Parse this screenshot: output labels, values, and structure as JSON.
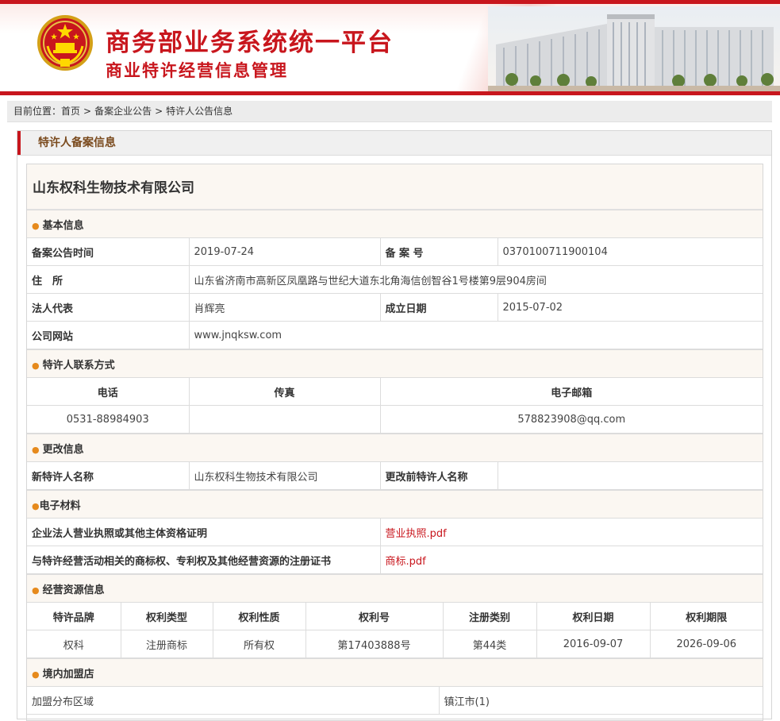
{
  "header": {
    "title_main": "商务部业务系统统一平台",
    "title_sub": "商业特许经营信息管理"
  },
  "breadcrumb": {
    "label": "目前位置：",
    "items": [
      "首页",
      "备案企业公告",
      "特许人公告信息"
    ],
    "separator": ">"
  },
  "panel": {
    "title": "特许人备案信息"
  },
  "company_name": "山东权科生物技术有限公司",
  "basic": {
    "section_title": "基本信息",
    "record_date_label": "备案公告时间",
    "record_date": "2019-07-24",
    "record_no_label": "备 案 号",
    "record_no": "0370100711900104",
    "address_label": "住　所",
    "address": "山东省济南市高新区凤凰路与世纪大道东北角海信创智谷1号楼第9层904房间",
    "legal_rep_label": "法人代表",
    "legal_rep": "肖辉亮",
    "founded_label": "成立日期",
    "founded": "2015-07-02",
    "website_label": "公司网站",
    "website": "www.jnqksw.com"
  },
  "contact": {
    "section_title": "特许人联系方式",
    "phone_label": "电话",
    "fax_label": "传真",
    "email_label": "电子邮箱",
    "phone": "0531-88984903",
    "fax": "",
    "email": "578823908@qq.com"
  },
  "change": {
    "section_title": "更改信息",
    "new_name_label": "新特许人名称",
    "new_name": "山东权科生物技术有限公司",
    "old_name_label": "更改前特许人名称",
    "old_name": ""
  },
  "materials": {
    "section_title": "电子材料",
    "license_label": "企业法人营业执照或其他主体资格证明",
    "license_file": "营业执照.pdf",
    "trademark_label": "与特许经营活动相关的商标权、专利权及其他经营资源的注册证书",
    "trademark_file": "商标.pdf"
  },
  "resources": {
    "section_title": "经营资源信息",
    "columns": [
      "特许品牌",
      "权利类型",
      "权利性质",
      "权利号",
      "注册类别",
      "权利日期",
      "权利期限"
    ],
    "rows": [
      [
        "权科",
        "注册商标",
        "所有权",
        "第17403888号",
        "第44类",
        "2016-09-07",
        "2026-09-06"
      ]
    ]
  },
  "stores": {
    "section_title": "境内加盟店",
    "region_label": "加盟分布区域",
    "region_value": "镇江市(1)"
  },
  "colors": {
    "brand_red": "#c8161d",
    "section_bg": "#fbf7f2",
    "dot_orange": "#e68a1d"
  }
}
